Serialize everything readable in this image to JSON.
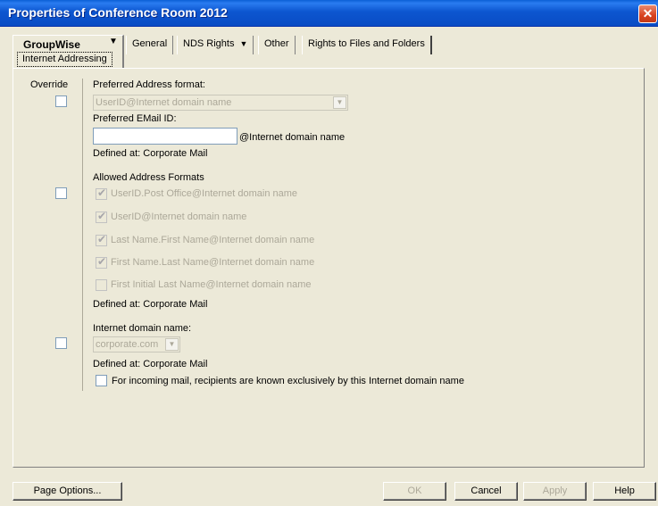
{
  "window": {
    "title": "Properties of Conference Room 2012",
    "close_glyph": "✕"
  },
  "tabs": {
    "active": {
      "label": "GroupWise",
      "sub_label": "Internet Addressing"
    },
    "others": [
      {
        "label": "General"
      },
      {
        "label": "NDS Rights"
      },
      {
        "label": "Other"
      },
      {
        "label": "Rights to Files and Folders"
      }
    ]
  },
  "override_label": "Override",
  "preferred_format": {
    "label": "Preferred Address format:",
    "value": "UserID@Internet domain name"
  },
  "preferred_email": {
    "label": "Preferred EMail ID:",
    "value": "",
    "suffix": "@Internet domain name",
    "defined_at": "Defined at:  Corporate Mail"
  },
  "allowed_formats": {
    "heading": "Allowed Address Formats",
    "options": [
      {
        "label": "UserID.Post Office@Internet domain name",
        "checked": true
      },
      {
        "label": "UserID@Internet domain name",
        "checked": true
      },
      {
        "label": "Last Name.First Name@Internet domain name",
        "checked": true
      },
      {
        "label": "First Name.Last Name@Internet domain name",
        "checked": true
      },
      {
        "label": "First Initial Last Name@Internet domain name",
        "checked": false
      }
    ],
    "defined_at": "Defined at:  Corporate Mail"
  },
  "internet_domain": {
    "label": "Internet domain name:",
    "value": "corporate.com",
    "defined_at": "Defined at:  Corporate Mail",
    "exclusive_label": "For incoming mail, recipients are known exclusively by this Internet domain name"
  },
  "buttons": {
    "page_options": "Page Options...",
    "ok": "OK",
    "cancel": "Cancel",
    "apply": "Apply",
    "help": "Help"
  },
  "icons": {
    "dropdown_arrow": "▼",
    "checkmark": "✔"
  }
}
